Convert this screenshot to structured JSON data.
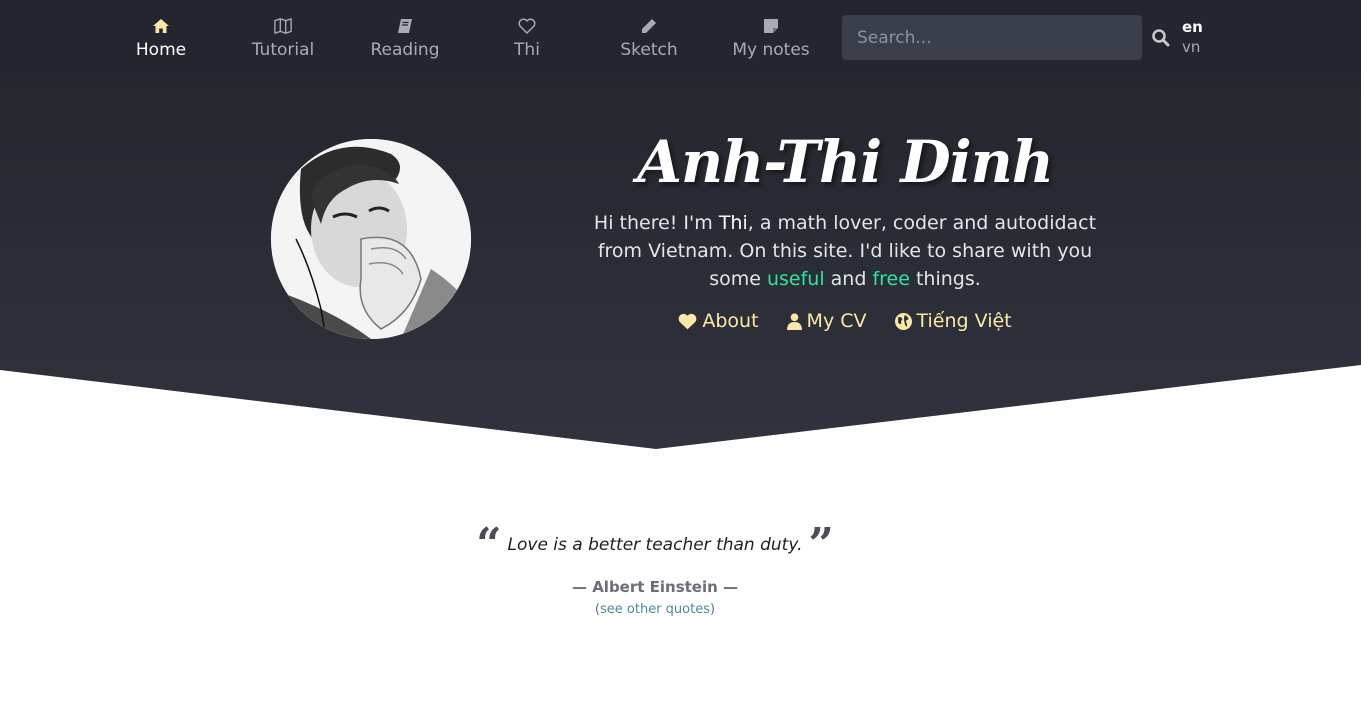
{
  "nav": {
    "items": [
      {
        "label": "Home",
        "icon": "home-icon",
        "active": true
      },
      {
        "label": "Tutorial",
        "icon": "map-icon"
      },
      {
        "label": "Reading",
        "icon": "book-icon"
      },
      {
        "label": "Thi",
        "icon": "heart-icon"
      },
      {
        "label": "Sketch",
        "icon": "pencil-icon"
      },
      {
        "label": "My notes",
        "icon": "note-icon"
      }
    ],
    "search_placeholder": "Search...",
    "lang_en": "en",
    "lang_vn": "vn"
  },
  "hero": {
    "title": "Anh-Thi Dinh",
    "intro_1": "Hi there! I'm ",
    "intro_name": "Thi",
    "intro_2": ", a math lover, coder and autodidact from Vietnam. On this site. I'd like to share with you some ",
    "intro_useful": "useful",
    "intro_3": " and ",
    "intro_free": "free",
    "intro_4": " things.",
    "links": {
      "about": "About",
      "cv": "My CV",
      "vietnamese": "Tiếng Việt"
    }
  },
  "quote": {
    "text": "Love is a better teacher than duty.",
    "author": "— Albert Einstein —",
    "more_open": "(",
    "more_link": "see other quotes",
    "more_close": ")"
  },
  "colors": {
    "nav_bg": "#23262e",
    "accent_yellow": "#fde7a6",
    "accent_green": "#2ee59d"
  }
}
